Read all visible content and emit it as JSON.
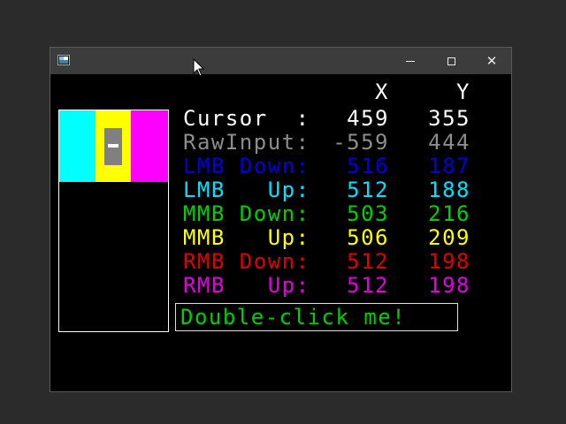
{
  "colors": {
    "cursor": "#ffffff",
    "raw": "#8c8c8c",
    "lmb_down": "#0000e0",
    "lmb_up": "#00e0ff",
    "mmb_down": "#00d000",
    "mmb_up": "#ffff00",
    "rmb_down": "#e00000",
    "rmb_up": "#e000e0",
    "band_1": "#00ffff",
    "band_2": "#ffff00",
    "band_3": "#ff00ff",
    "double_click": "#00d000"
  },
  "titlebar": {
    "icons": [
      "app-icon",
      "minimize-icon",
      "maximize-icon",
      "close-icon"
    ],
    "close_glyph": "✕"
  },
  "headers": {
    "x": "X",
    "y": "Y"
  },
  "rows": [
    {
      "label": "Cursor  :",
      "x": "459",
      "y": "355"
    },
    {
      "label": "RawInput:",
      "x": "-559",
      "y": "444"
    },
    {
      "label": "LMB Down:",
      "x": "516",
      "y": "187"
    },
    {
      "label": "LMB   Up:",
      "x": "512",
      "y": "188"
    },
    {
      "label": "MMB Down:",
      "x": "503",
      "y": "216"
    },
    {
      "label": "MMB   Up:",
      "x": "506",
      "y": "209"
    },
    {
      "label": "RMB Down:",
      "x": "512",
      "y": "198"
    },
    {
      "label": "RMB   Up:",
      "x": "512",
      "y": "198"
    }
  ],
  "double_click_label": "Double-click me!"
}
